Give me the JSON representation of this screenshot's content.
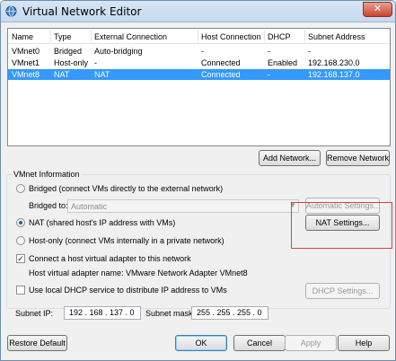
{
  "window": {
    "title": "Virtual Network Editor",
    "close_label": "✕",
    "icon": "globe-network-icon"
  },
  "table": {
    "headers": [
      "Name",
      "Type",
      "External Connection",
      "Host Connection",
      "DHCP",
      "Subnet Address"
    ],
    "rows": [
      {
        "name": "VMnet0",
        "type": "Bridged",
        "external": "Auto-bridging",
        "host": "-",
        "dhcp": "-",
        "subnet": "-"
      },
      {
        "name": "VMnet1",
        "type": "Host-only",
        "external": "-",
        "host": "Connected",
        "dhcp": "Enabled",
        "subnet": "192.168.230.0"
      },
      {
        "name": "VMnet8",
        "type": "NAT",
        "external": "NAT",
        "host": "Connected",
        "dhcp": "-",
        "subnet": "192.168.137.0"
      }
    ],
    "selected_index": 2
  },
  "buttons": {
    "add_network": "Add Network...",
    "remove_network": "Remove Network",
    "automatic_settings": "Automatic Settings...",
    "nat_settings": "NAT Settings...",
    "dhcp_settings": "DHCP Settings...",
    "restore_default": "Restore Default",
    "ok": "OK",
    "cancel": "Cancel",
    "apply": "Apply",
    "help": "Help"
  },
  "vmnet_info": {
    "group_title": "VMnet Information",
    "bridged_label": "Bridged (connect VMs directly to the external network)",
    "bridged_to_label": "Bridged to:",
    "bridged_to_value": "Automatic",
    "nat_label": "NAT (shared host's IP address with VMs)",
    "hostonly_label": "Host-only (connect VMs internally in a private network)",
    "selected_mode": "nat",
    "connect_adapter_label": "Connect a host virtual adapter to this network",
    "connect_adapter_checked": true,
    "adapter_name_text": "Host virtual adapter name: VMware Network Adapter VMnet8",
    "use_dhcp_label": "Use local DHCP service to distribute IP address to VMs",
    "use_dhcp_checked": false
  },
  "subnet": {
    "ip_label": "Subnet IP:",
    "ip_value": "192 . 168 . 137 .  0",
    "mask_label": "Subnet mask:",
    "mask_value": "255 . 255 . 255 .  0"
  },
  "colors": {
    "selection": "#3399ff",
    "highlight_box": "#e53b3b",
    "title_bar": "#c5d9ef"
  }
}
